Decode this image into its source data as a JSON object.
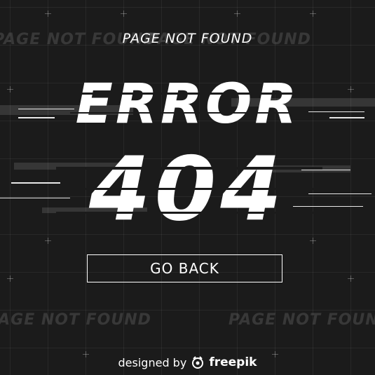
{
  "page": {
    "subtitle": "PAGE NOT FOUND",
    "headline": "ERROR",
    "code": "404",
    "ghost_text": "PAGE NOT FOUND",
    "button_label": "GO BACK",
    "credit_prefix": "designed by",
    "credit_brand": "freepik"
  },
  "colors": {
    "background": "#1b1b1b",
    "foreground": "#ffffff"
  }
}
